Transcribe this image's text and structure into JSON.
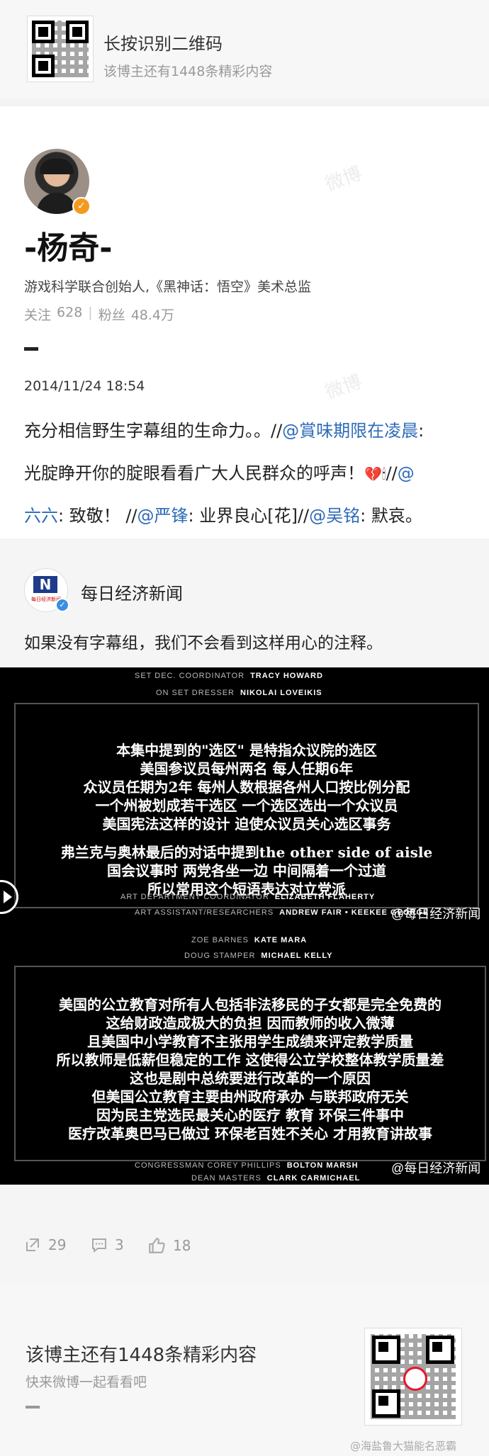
{
  "top_banner": {
    "title": "长按识别二维码",
    "subtitle": "该博主还有1448条精彩内容"
  },
  "profile": {
    "name": "-杨奇-",
    "bio": "游戏科学联合创始人,《黑神话：悟空》美术总监",
    "following_label": "关注",
    "following_count": "628",
    "followers_label": "粉丝",
    "followers_count": "48.4万"
  },
  "post": {
    "timestamp": "2014/11/24 18:54",
    "line1_text": "充分相信野生字幕组的生命力。。//",
    "line1_mention": "@賞味期限在凌晨",
    "line1_end": ":",
    "line2_text": "光腚睁开你的腚眼看看广大人民群众的呼声！",
    "line2_emoji": "💔🕯",
    "line2_slash": "//",
    "line2_at": "@",
    "line3_mention1": "六六",
    "line3_text1": ": 致敬！ //",
    "line3_mention2": "@严锋",
    "line3_text2": ": 业界良心[花]//",
    "line3_mention3": "@吴铭",
    "line3_text3": ": 默哀。"
  },
  "repost": {
    "author": "每日经济新闻",
    "avatar_text": "每日经济新闻",
    "text": "如果没有字幕组，我们不会看到这样用心的注释。"
  },
  "image1": {
    "credits_top": [
      {
        "role": "SET DEC. COORDINATOR",
        "name": "TRACY HOWARD"
      },
      {
        "role": "ON SET DRESSER",
        "name": "NIKOLAI LOVEIKIS"
      }
    ],
    "subtitle_lines": [
      "本集中提到的\"选区\" 是特指众议院的选区",
      "美国参议员每州两名  每人任期6年",
      "众议员任期为2年  每州人数根据各州人口按比例分配",
      "一个州被划成若干选区  一个选区选出一个众议员",
      "美国宪法这样的设计  迫使众议员关心选区事务"
    ],
    "subtitle_lines2": [
      "弗兰克与奥林最后的对话中提到the other side of aisle",
      "国会议事时  两党各坐一边  中间隔着一个过道",
      "所以常用这个短语表达对立党派"
    ],
    "credits_bottom": [
      {
        "role": "ART DEPARTMENT COORDINATOR",
        "name": "ELIZABETH FLAHERTY"
      },
      {
        "role": "ART ASSISTANT/RESEARCHERS",
        "name": "ANDREW FAIR • KEEKEE GEORGE"
      }
    ],
    "watermark": "@每日经济新闻"
  },
  "image2": {
    "credits_top": [
      {
        "role": "ZOE BARNES",
        "name": "KATE MARA"
      },
      {
        "role": "DOUG STAMPER",
        "name": "MICHAEL KELLY"
      }
    ],
    "subtitle_lines": [
      "美国的公立教育对所有人包括非法移民的子女都是完全免费的",
      "这给财政造成极大的负担  因而教师的收入微薄",
      "且美国中小学教育不主张用学生成绩来评定教学质量",
      "所以教师是低薪但稳定的工作  这使得公立学校整体教学质量差",
      "这也是剧中总统要进行改革的一个原因",
      "但美国公立教育主要由州政府承办  与联邦政府无关",
      "因为民主党选民最关心的医疗  教育  环保三件事中",
      "医疗改革奥巴马已做过  环保老百姓不关心  才用教育讲故事"
    ],
    "credits_bottom": [
      {
        "role": "CONGRESSMAN COREY PHILLIPS",
        "name": "BOLTON MARSH"
      },
      {
        "role": "DEAN MASTERS",
        "name": "CLARK CARMICHAEL"
      }
    ],
    "watermark": "@每日经济新闻"
  },
  "actions": {
    "repost_count": "29",
    "comment_count": "3",
    "like_count": "18"
  },
  "bottom_banner": {
    "title": "该博主还有1448条精彩内容",
    "subtitle": "快来微博一起看看吧"
  },
  "footer_watermark": "@海盐鲁大猫能名恶霸",
  "bg_watermark": "微博"
}
